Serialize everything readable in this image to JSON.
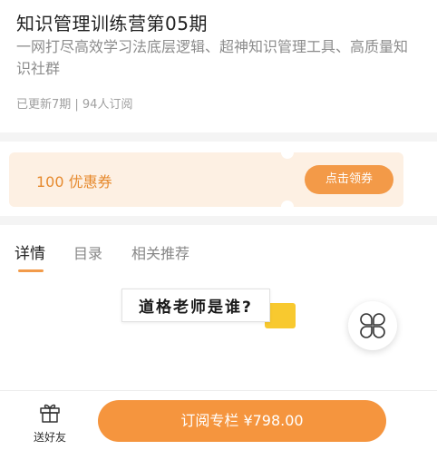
{
  "course": {
    "title": "知识管理训练营第05期",
    "description": "一网打尽高效学习法底层逻辑、超神知识管理工具、高质量知识社群",
    "meta": "已更新7期 | 94人订阅"
  },
  "coupon": {
    "amount_label": "100 优惠券",
    "claim_label": "点击领券"
  },
  "tabs": [
    {
      "label": "详情",
      "active": true
    },
    {
      "label": "目录",
      "active": false
    },
    {
      "label": "相关推荐",
      "active": false
    }
  ],
  "content": {
    "heading": "道格老师是谁?"
  },
  "bottom_bar": {
    "gift_label": "送好友",
    "subscribe_label": "订阅专栏 ¥798.00"
  },
  "colors": {
    "accent": "#f5953e",
    "coupon_bg": "#fdf0e3",
    "coupon_text": "#e68a2e",
    "heading_accent": "#f8c92f"
  },
  "icons": {
    "floating_menu": "four-petal-menu-icon",
    "gift": "gift-icon"
  }
}
